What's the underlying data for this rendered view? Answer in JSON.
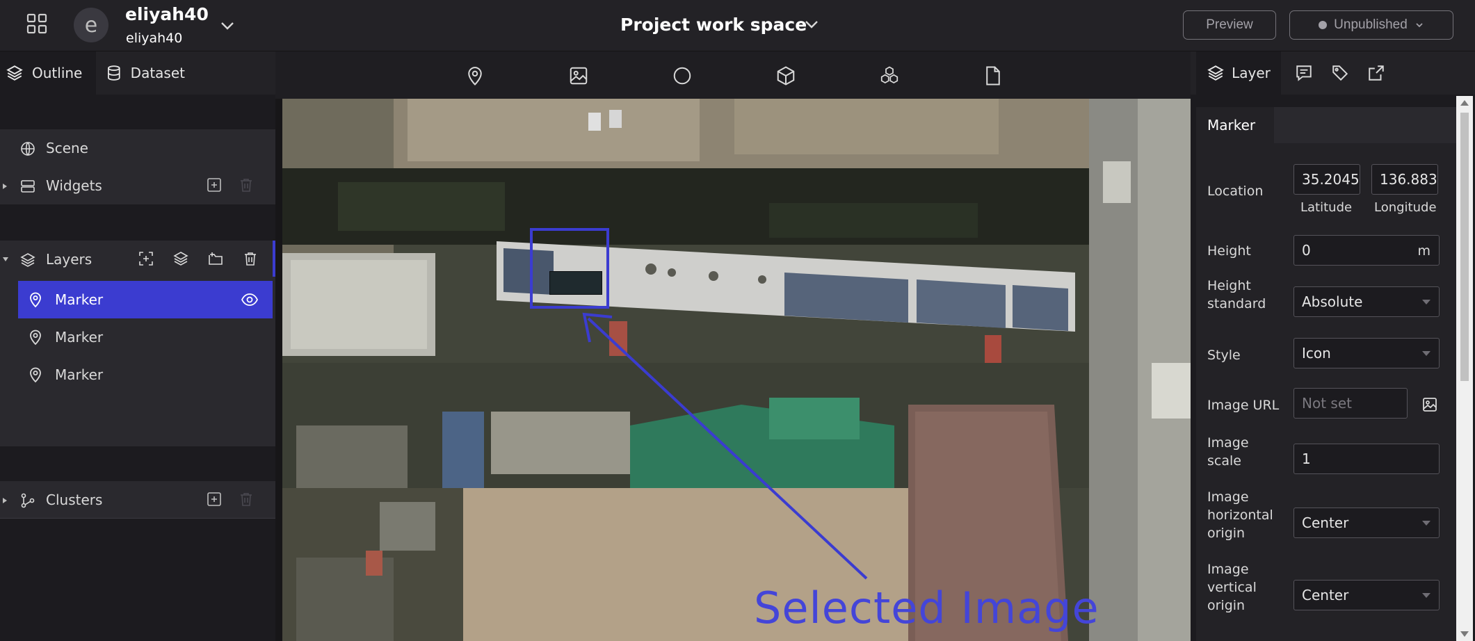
{
  "header": {
    "user_initial": "e",
    "user_name": "eliyah40",
    "user_sub": "eliyah40",
    "project_title": "Project work space",
    "preview_label": "Preview",
    "publish_label": "Unpublished"
  },
  "left_panel": {
    "tabs": [
      {
        "label": "Outline",
        "icon": "layers-icon"
      },
      {
        "label": "Dataset",
        "icon": "database-icon"
      }
    ],
    "scene_label": "Scene",
    "widgets_label": "Widgets",
    "layers_label": "Layers",
    "markers": [
      {
        "label": "Marker",
        "selected": true
      },
      {
        "label": "Marker",
        "selected": false
      },
      {
        "label": "Marker",
        "selected": false
      }
    ],
    "clusters_label": "Clusters"
  },
  "toolbar": {
    "tools": [
      "marker-pin-icon",
      "image-icon",
      "circle-icon",
      "cube-icon",
      "model-3d-icon",
      "file-icon"
    ]
  },
  "map": {
    "annotation_label": "Selected Image",
    "annotation_color": "#3b3cd0"
  },
  "right_panel": {
    "tabs": [
      {
        "label": "Layer",
        "icon": "layers-icon"
      },
      {
        "label": "",
        "icon": "infobox-icon"
      },
      {
        "label": "",
        "icon": "tag-icon"
      },
      {
        "label": "",
        "icon": "export-icon"
      }
    ],
    "subtab": "Marker",
    "location": {
      "label": "Location",
      "latitude": "35.2045",
      "longitude": "136.8832",
      "latitude_label": "Latitude",
      "longitude_label": "Longitude"
    },
    "height": {
      "label": "Height",
      "value": "0",
      "unit": "m"
    },
    "height_standard": {
      "label_1": "Height",
      "label_2": "standard",
      "value": "Absolute"
    },
    "style": {
      "label": "Style",
      "value": "Icon"
    },
    "image_url": {
      "label": "Image URL",
      "placeholder": "Not set"
    },
    "image_scale": {
      "label_1": "Image",
      "label_2": "scale",
      "value": "1"
    },
    "image_horizontal_origin": {
      "label_1": "Image",
      "label_2": "horizontal",
      "label_3": "origin",
      "value": "Center"
    },
    "image_vertical_origin": {
      "label_1": "Image",
      "label_2": "vertical",
      "label_3": "origin",
      "value": "Center"
    }
  },
  "colors": {
    "accent": "#3b3cd0",
    "background": "#171618",
    "panel": "#232226"
  }
}
